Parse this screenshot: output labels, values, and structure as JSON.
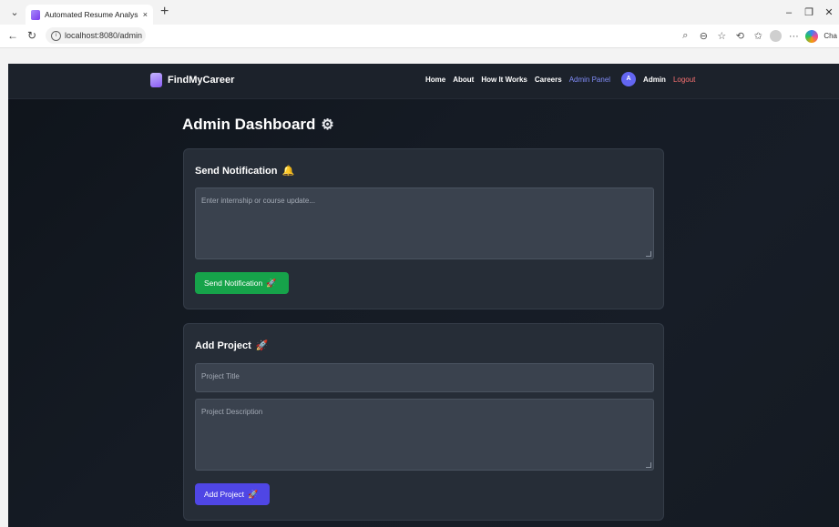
{
  "browser": {
    "tab_title": "Automated Resume Analysis & Sk",
    "tab_close": "×",
    "new_tab": "+",
    "url": "localhost:8080/admin",
    "copilot_label": "Cha",
    "window": {
      "minimize": "–",
      "maximize": "❐",
      "close": "✕"
    }
  },
  "app": {
    "brand": "FindMyCareer",
    "nav": {
      "home": "Home",
      "about": "About",
      "how_it_works": "How It Works",
      "careers": "Careers",
      "admin_panel": "Admin Panel",
      "avatar_initial": "A",
      "user": "Admin",
      "logout": "Logout"
    },
    "page_title": "Admin Dashboard",
    "notification_card": {
      "heading": "Send Notification",
      "textarea_placeholder": "Enter internship or course update...",
      "button": "Send Notification"
    },
    "project_card": {
      "heading": "Add Project",
      "title_placeholder": "Project Title",
      "description_placeholder": "Project Description",
      "button": "Add Project"
    }
  },
  "colors": {
    "accent": "#4f46e5",
    "success": "#16a34a",
    "logout": "#f87171",
    "active_nav": "#818cf8"
  },
  "icons": {
    "brand": "briefcase-logo-icon",
    "title": "gear-icon",
    "notification": "bell-icon",
    "project": "rocket-icon"
  }
}
